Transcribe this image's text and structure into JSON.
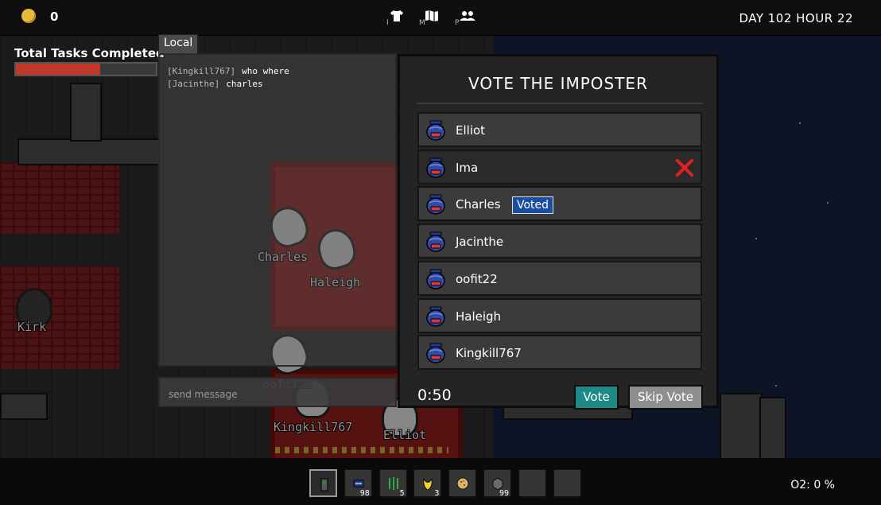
{
  "topbar": {
    "coins": "0",
    "hotkeys": {
      "inventory": "I",
      "map": "M",
      "players": "P"
    },
    "day_hour": "DAY 102 HOUR 22"
  },
  "tasks": {
    "label": "Total Tasks Completed",
    "progress_fraction": 0.6
  },
  "chat": {
    "tab": "Local",
    "messages": [
      {
        "user": "[Kingkill767]",
        "text": "who where"
      },
      {
        "user": "[Jacinthe]",
        "text": "charles"
      }
    ],
    "input_placeholder": "send message"
  },
  "world_labels": [
    "Charles",
    "Haleigh",
    "Kirk",
    "oofit22",
    "Kingkill767",
    "Elliot"
  ],
  "vote": {
    "title": "VOTE THE IMPOSTER",
    "players": [
      {
        "name": "Elliot",
        "voted": false,
        "eliminated": false
      },
      {
        "name": "Ima",
        "voted": false,
        "eliminated": true
      },
      {
        "name": "Charles",
        "voted": true,
        "eliminated": false
      },
      {
        "name": "Jacinthe",
        "voted": false,
        "eliminated": false
      },
      {
        "name": "oofit22",
        "voted": false,
        "eliminated": false
      },
      {
        "name": "Haleigh",
        "voted": false,
        "eliminated": false
      },
      {
        "name": "Kingkill767",
        "voted": false,
        "eliminated": false
      }
    ],
    "voted_label": "Voted",
    "timer": "0:50",
    "vote_button": "Vote",
    "skip_button": "Skip Vote"
  },
  "hotbar": {
    "slots": [
      {
        "icon": "radio-icon",
        "count": ""
      },
      {
        "icon": "keycard-icon",
        "count": "98"
      },
      {
        "icon": "cable-icon",
        "count": "5"
      },
      {
        "icon": "banana-icon",
        "count": "3"
      },
      {
        "icon": "cookie-icon",
        "count": ""
      },
      {
        "icon": "ore-icon",
        "count": "99"
      },
      {
        "icon": "empty",
        "count": ""
      },
      {
        "icon": "empty",
        "count": ""
      }
    ],
    "oxygen": "O2: 0 %"
  },
  "colors": {
    "task_fill": "#c0392b",
    "vote_button": "#1d8a85",
    "voted_badge": "#1b4ea0",
    "x_mark": "#e02020"
  }
}
